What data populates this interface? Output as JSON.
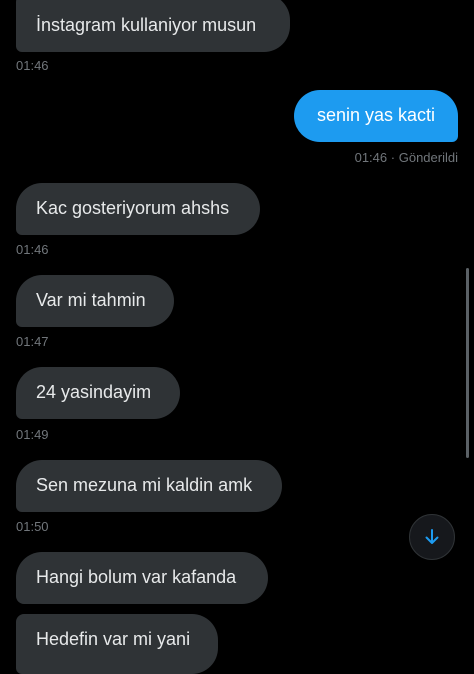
{
  "messages": [
    {
      "text": "İnstagram kullaniyor musun",
      "time": "01:46",
      "direction": "in"
    },
    {
      "text": "senin yas kacti",
      "time": "01:46",
      "status": "Gönderildi",
      "separator": "·",
      "direction": "out"
    },
    {
      "text": "Kac gosteriyorum ahshs",
      "time": "01:46",
      "direction": "in"
    },
    {
      "text": "Var mi tahmin",
      "time": "01:47",
      "direction": "in"
    },
    {
      "text": "24 yasindayim",
      "time": "01:49",
      "direction": "in"
    },
    {
      "text": "Sen mezuna mi kaldin amk",
      "time": "01:50",
      "direction": "in"
    },
    {
      "text": "Hangi bolum var kafanda",
      "direction": "in"
    },
    {
      "text": "Hedefin var mi yani",
      "direction": "in"
    }
  ],
  "jump_button": {
    "icon": "arrow-down-icon"
  },
  "colors": {
    "background": "#000000",
    "incoming_bubble": "#2f3336",
    "outgoing_bubble": "#1d9bf0",
    "timestamp": "#71767b",
    "accent": "#1d9bf0"
  }
}
